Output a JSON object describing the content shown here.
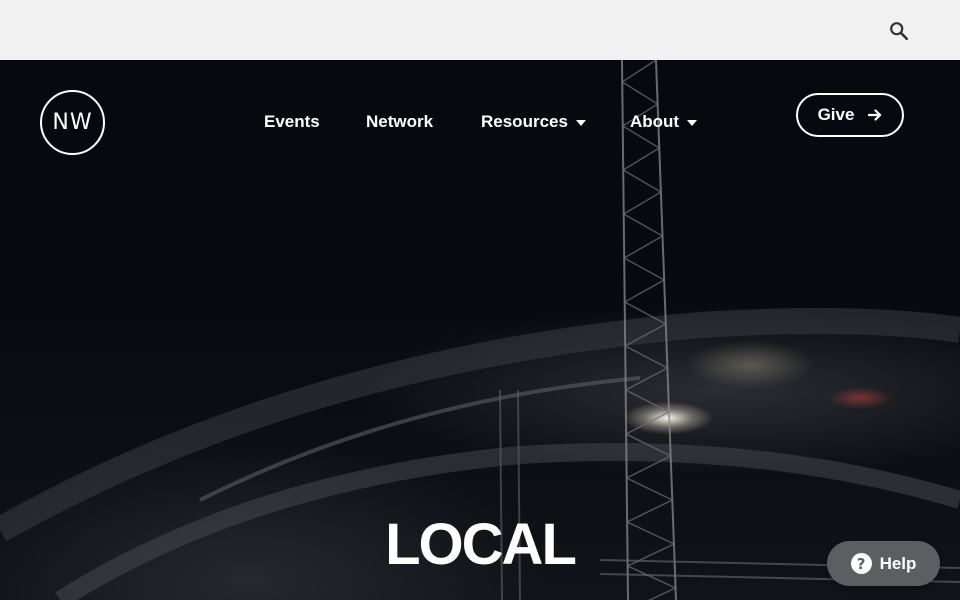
{
  "topbar": {
    "search_icon": "search-icon"
  },
  "nav": {
    "logo_text": "NW",
    "items": [
      {
        "label": "Events",
        "has_dropdown": false
      },
      {
        "label": "Network",
        "has_dropdown": false
      },
      {
        "label": "Resources",
        "has_dropdown": true
      },
      {
        "label": "About",
        "has_dropdown": true
      }
    ],
    "give_label": "Give",
    "give_icon": "arrow-right-icon"
  },
  "hero": {
    "title": "LOCAL",
    "background_description_icon": "stage-truss-image"
  },
  "help": {
    "label": "Help",
    "icon_glyph": "?"
  },
  "colors": {
    "topbar_bg": "#f1f1f1",
    "hero_bg": "#07090f",
    "text": "#ffffff",
    "help_bg": "#5d5e62"
  }
}
